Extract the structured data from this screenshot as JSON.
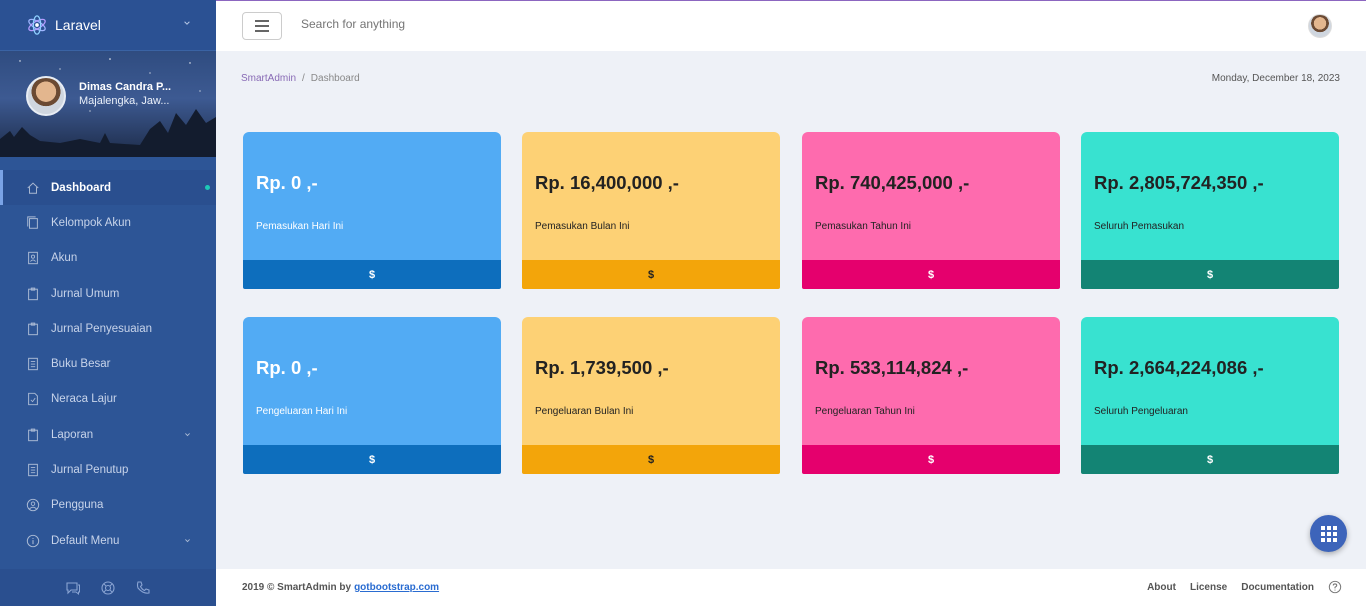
{
  "brand": {
    "name": "Laravel"
  },
  "profile": {
    "name": "Dimas Candra P...",
    "location": "Majalengka, Jaw..."
  },
  "sidebar": {
    "items": [
      {
        "label": "Dashboard",
        "icon": "home-icon"
      },
      {
        "label": "Kelompok Akun",
        "icon": "copy-icon"
      },
      {
        "label": "Akun",
        "icon": "user-file-icon"
      },
      {
        "label": "Jurnal Umum",
        "icon": "clipboard-icon"
      },
      {
        "label": "Jurnal Penyesuaian",
        "icon": "clipboard-icon"
      },
      {
        "label": "Buku Besar",
        "icon": "book-icon"
      },
      {
        "label": "Neraca Lajur",
        "icon": "checked-file-icon"
      },
      {
        "label": "Laporan",
        "icon": "clipboard-icon"
      },
      {
        "label": "Jurnal Penutup",
        "icon": "book-icon"
      },
      {
        "label": "Pengguna",
        "icon": "user-circle-icon"
      },
      {
        "label": "Default Menu",
        "icon": "info-icon"
      }
    ]
  },
  "header": {
    "search_placeholder": "Search for anything"
  },
  "breadcrumb": {
    "root": "SmartAdmin",
    "separator": "/",
    "current": "Dashboard"
  },
  "date": "Monday, December 18, 2023",
  "cards": [
    {
      "value": "Rp. 0 ,-",
      "label": "Pemasukan Hari Ini",
      "footer": "$"
    },
    {
      "value": "Rp. 16,400,000 ,-",
      "label": "Pemasukan Bulan Ini",
      "footer": "$"
    },
    {
      "value": "Rp. 740,425,000 ,-",
      "label": "Pemasukan Tahun Ini",
      "footer": "$"
    },
    {
      "value": "Rp. 2,805,724,350 ,-",
      "label": "Seluruh Pemasukan",
      "footer": "$"
    },
    {
      "value": "Rp. 0 ,-",
      "label": "Pengeluaran Hari Ini",
      "footer": "$"
    },
    {
      "value": "Rp. 1,739,500 ,-",
      "label": "Pengeluaran Bulan Ini",
      "footer": "$"
    },
    {
      "value": "Rp. 533,114,824 ,-",
      "label": "Pengeluaran Tahun Ini",
      "footer": "$"
    },
    {
      "value": "Rp. 2,664,224,086 ,-",
      "label": "Seluruh Pengeluaran",
      "footer": "$"
    }
  ],
  "footer": {
    "text": "2019 © SmartAdmin by",
    "link": "gotbootstrap.com",
    "links": [
      "About",
      "License",
      "Documentation"
    ]
  },
  "colors": {
    "sidebar": "#2d5596",
    "accent": "#886ab5",
    "blue": "#52abf4",
    "yellow": "#fdd175",
    "pink": "#fe6bae",
    "teal": "#38e2d0"
  }
}
